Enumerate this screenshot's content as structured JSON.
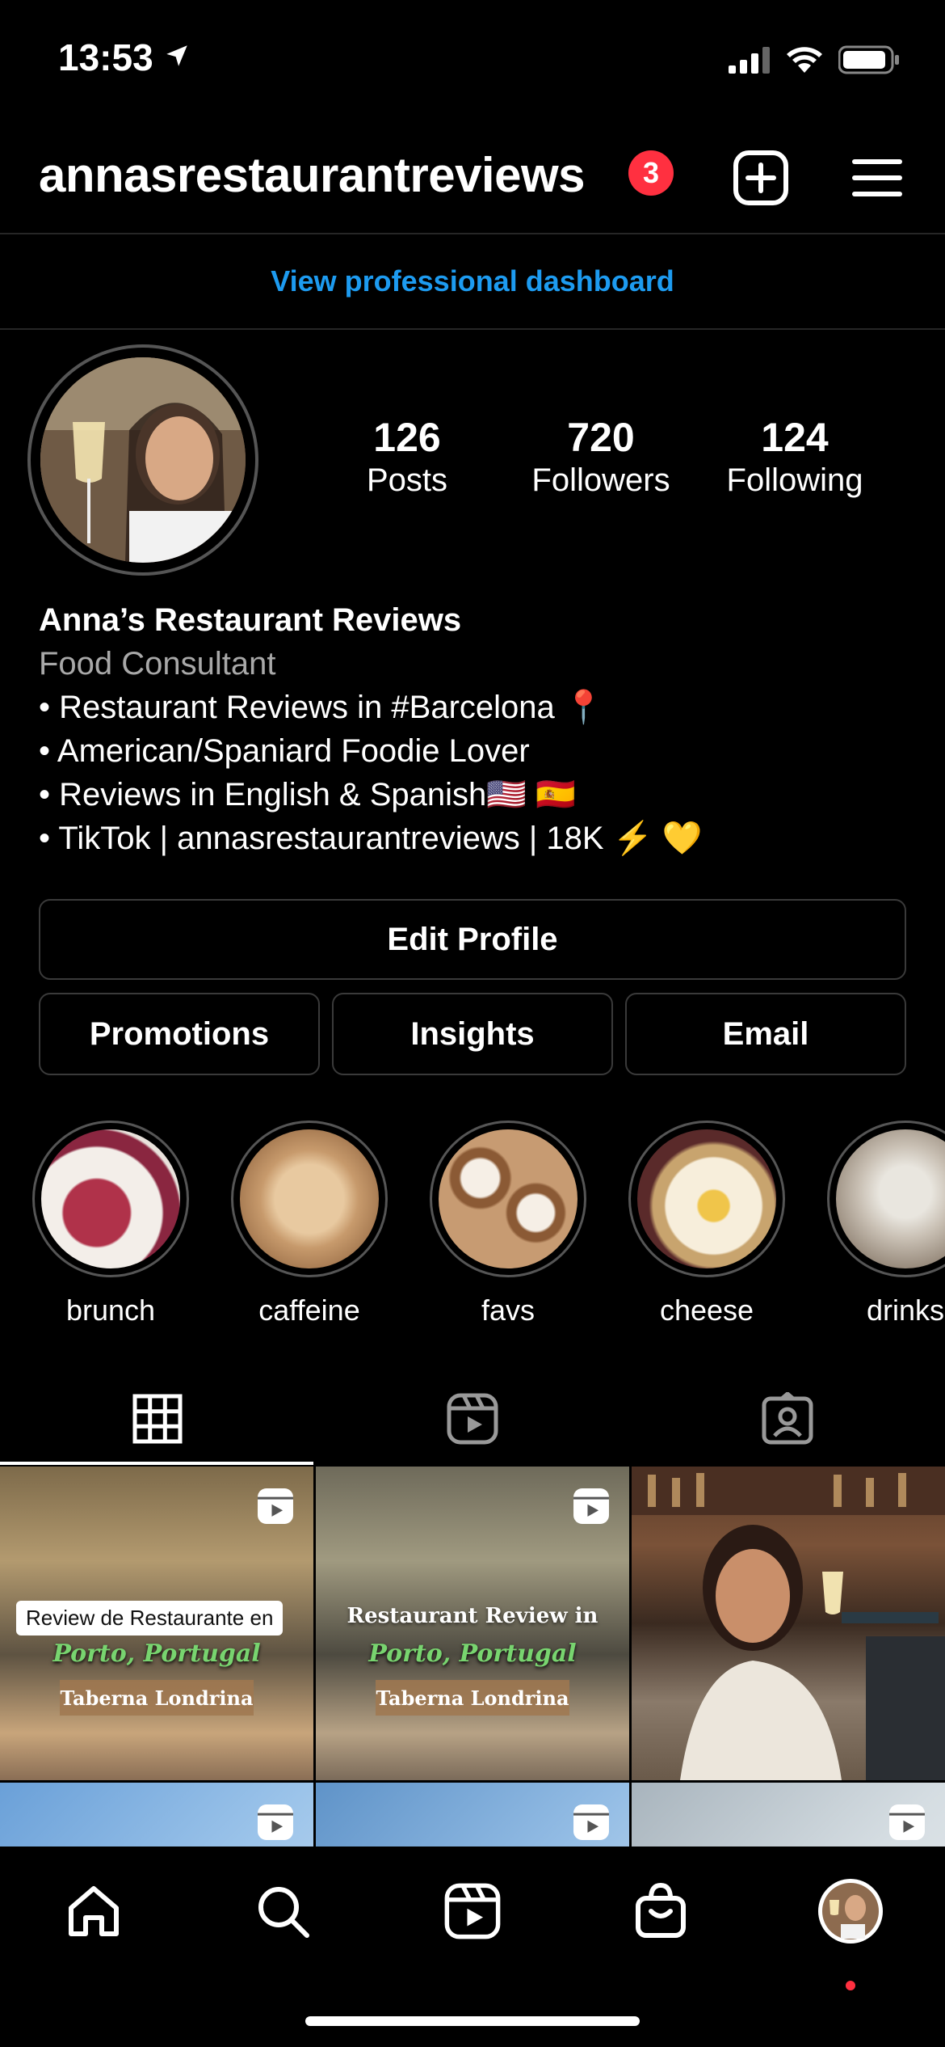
{
  "status_bar": {
    "time": "13:53"
  },
  "header": {
    "username": "annasrestaurantreviews",
    "notification_count": "3",
    "icons": [
      "plus-square-icon",
      "menu-icon"
    ]
  },
  "dashboard": {
    "label": "View professional dashboard"
  },
  "stats": [
    {
      "value": "126",
      "label": "Posts"
    },
    {
      "value": "720",
      "label": "Followers"
    },
    {
      "value": "124",
      "label": "Following"
    }
  ],
  "bio": {
    "name": "Anna’s Restaurant Reviews",
    "category": "Food Consultant",
    "lines": [
      "• Restaurant Reviews in #Barcelona 📍",
      "• American/Spaniard Foodie Lover",
      "• Reviews in English & Spanish🇺🇸 🇪🇸",
      "• TikTok | annasrestaurantreviews | 18K ⚡️ 💛"
    ]
  },
  "buttons": {
    "edit_profile": "Edit Profile",
    "promotions": "Promotions",
    "insights": "Insights",
    "email": "Email"
  },
  "highlights": [
    {
      "label": "brunch"
    },
    {
      "label": "caffeine"
    },
    {
      "label": "favs"
    },
    {
      "label": "cheese"
    },
    {
      "label": "drinks"
    }
  ],
  "tabs": [
    "grid-icon",
    "reels-icon",
    "tagged-icon"
  ],
  "posts": [
    {
      "caption_top": "Review de Restaurante en",
      "caption_script": "Porto, Portugal",
      "caption_tag": "Taberna Londrina"
    },
    {
      "caption_top": "Restaurant Review in",
      "caption_script": "Porto, Portugal",
      "caption_tag": "Taberna Londrina"
    }
  ],
  "colors": {
    "accent_link": "#1d9bf0",
    "badge": "#ff3040",
    "background": "#000000"
  }
}
